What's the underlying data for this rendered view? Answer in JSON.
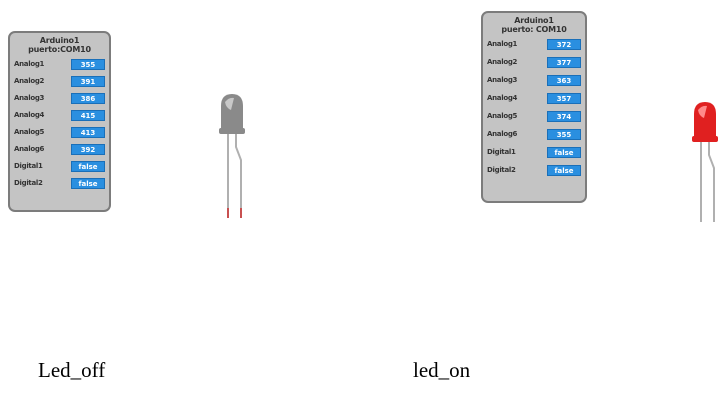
{
  "panels": {
    "off": {
      "title_line1": "Arduino1",
      "title_line2": "puerto:COM10",
      "rows": [
        {
          "label": "Analog1",
          "value": "355"
        },
        {
          "label": "Analog2",
          "value": "391"
        },
        {
          "label": "Analog3",
          "value": "386"
        },
        {
          "label": "Analog4",
          "value": "415"
        },
        {
          "label": "Analog5",
          "value": "413"
        },
        {
          "label": "Analog6",
          "value": "392"
        },
        {
          "label": "Digital1",
          "value": "false"
        },
        {
          "label": "Digital2",
          "value": "false"
        }
      ]
    },
    "on": {
      "title_line1": "Arduino1",
      "title_line2": "puerto: COM10",
      "rows": [
        {
          "label": "Analog1",
          "value": "372"
        },
        {
          "label": "Analog2",
          "value": "377"
        },
        {
          "label": "Analog3",
          "value": "363"
        },
        {
          "label": "Analog4",
          "value": "357"
        },
        {
          "label": "Analog5",
          "value": "374"
        },
        {
          "label": "Analog6",
          "value": "355"
        },
        {
          "label": "Digital1",
          "value": "false"
        },
        {
          "label": "Digital2",
          "value": "false"
        }
      ]
    }
  },
  "leds": {
    "off": {
      "state": "off",
      "body_color": "#8a8a8a",
      "highlight_color": "#c8c8c8"
    },
    "on": {
      "state": "on",
      "body_color": "#e02020",
      "highlight_color": "#ff8a8a"
    }
  },
  "captions": {
    "off": "Led_off",
    "on": "led_on"
  },
  "colors": {
    "panel_bg": "#c4c4c4",
    "value_bg": "#2a8fe0",
    "lead_color": "#b0b0b0",
    "lead_tip": "#c85050"
  }
}
